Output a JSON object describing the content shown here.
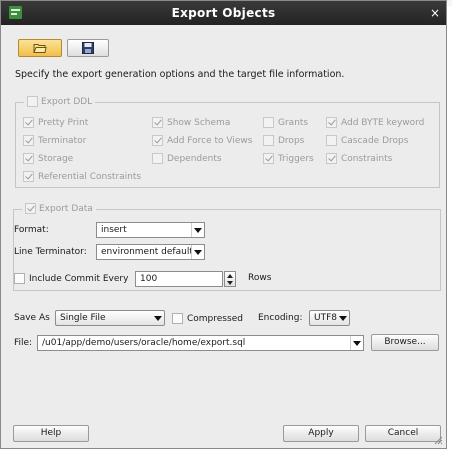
{
  "background": {
    "snippet": "..."
  },
  "window": {
    "title": "Export Objects",
    "close_glyph": "×",
    "icons": {
      "app": "app-icon",
      "close": "close-icon"
    }
  },
  "toolbar": {
    "items": [
      {
        "icon": "folder-open-icon",
        "active": true
      },
      {
        "icon": "save-floppy-icon",
        "active": false
      }
    ]
  },
  "instructions": "Specify the export generation options and the target file information.",
  "export_ddl": {
    "label": "Export DDL",
    "checked": false,
    "enabled": false,
    "options": [
      {
        "label": "Pretty Print",
        "checked": true
      },
      {
        "label": "Show Schema",
        "checked": true
      },
      {
        "label": "Grants",
        "checked": false
      },
      {
        "label": "Add BYTE keyword",
        "checked": true
      },
      {
        "label": "Terminator",
        "checked": true
      },
      {
        "label": "Add Force to Views",
        "checked": true
      },
      {
        "label": "Drops",
        "checked": false
      },
      {
        "label": "Cascade Drops",
        "checked": false
      },
      {
        "label": "Storage",
        "checked": true
      },
      {
        "label": "Dependents",
        "checked": false
      },
      {
        "label": "Triggers",
        "checked": true
      },
      {
        "label": "Constraints",
        "checked": true
      },
      {
        "label": "Referential Constraints",
        "checked": true
      }
    ]
  },
  "export_data": {
    "label": "Export Data",
    "checked": true,
    "format": {
      "label": "Format:",
      "value": "insert"
    },
    "line_terminator": {
      "label": "Line Terminator:",
      "value": "environment default"
    },
    "include_commit": {
      "label": "Include Commit Every",
      "checked": false,
      "value": "100",
      "unit": "Rows"
    }
  },
  "save_as": {
    "label": "Save As",
    "value": "Single File",
    "compressed": {
      "label": "Compressed",
      "checked": false
    },
    "encoding": {
      "label": "Encoding:",
      "value": "UTF8"
    }
  },
  "file": {
    "label": "File:",
    "value": "/u01/app/demo/users/oracle/home/export.sql",
    "browse_label": "Browse..."
  },
  "buttons": {
    "help": "Help",
    "apply": "Apply",
    "cancel": "Cancel"
  },
  "colors": {
    "titlebar": "#2b2b2b",
    "dialog_bg": "#ececec",
    "active_tool": "#f5c95a"
  }
}
